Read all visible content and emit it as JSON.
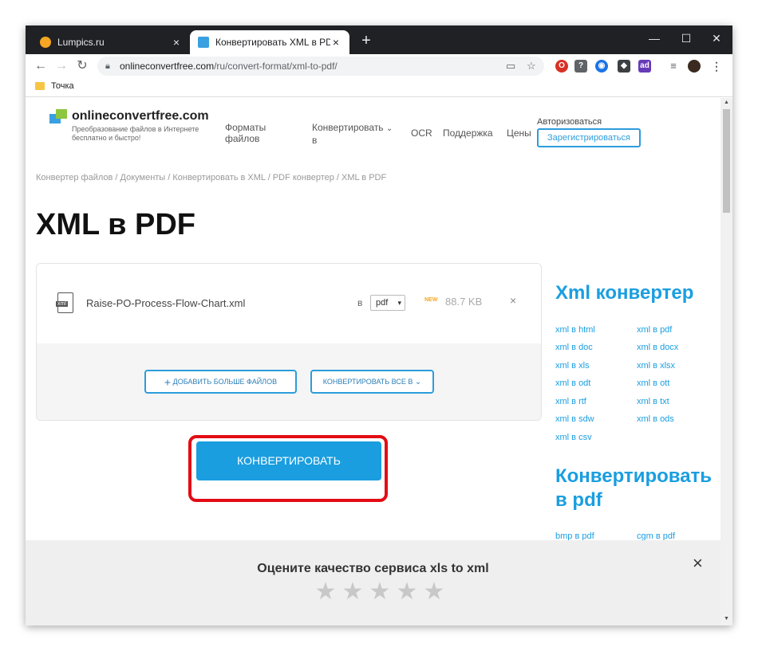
{
  "browser": {
    "tabs": [
      {
        "label": "Lumpics.ru",
        "favicon_color": "#f5a623"
      },
      {
        "label": "Конвертировать XML в PDF онлайн",
        "favicon_color": "#3aa0e0"
      }
    ],
    "url_domain": "onlineconvertfree.com",
    "url_path": "/ru/convert-format/xml-to-pdf/",
    "bookmarks": [
      {
        "label": "Точка"
      }
    ]
  },
  "site": {
    "logo_name": "onlineconvertfree.com",
    "logo_tagline": "Преобразование файлов в Интернете бесплатно и быстро!",
    "nav": {
      "formats_line1": "Форматы",
      "formats_line2": "файлов",
      "convert_line1": "Конвертировать",
      "convert_line2": "в",
      "ocr": "OCR",
      "support": "Поддержка",
      "prices": "Цены"
    },
    "login": "Авторизоваться",
    "register": "Зарегистрироваться"
  },
  "breadcrumbs": "Конвертер файлов / Документы / Конвертировать в XML / PDF конвертер / XML в PDF",
  "page_title": "XML в PDF",
  "converter": {
    "file": {
      "name": "Raise-PO-Process-Flow-Chart.xml",
      "icon_text": "xml",
      "to_label": "в",
      "format": "pdf",
      "new_badge": "NEW",
      "size": "88.7 KB",
      "remove": "×"
    },
    "add_more": "Добавить больше файлов",
    "convert_all": "Конвертировать все в",
    "convert_button": "Конвертировать"
  },
  "sidebar": {
    "xml_title": "Xml конвертер",
    "xml_links": [
      "xml в html",
      "xml в pdf",
      "xml в doc",
      "xml в docx",
      "xml в xls",
      "xml в xlsx",
      "xml в odt",
      "xml в ott",
      "xml в rtf",
      "xml в txt",
      "xml в sdw",
      "xml в ods",
      "xml в csv"
    ],
    "pdf_title_line1": "Конвертировать",
    "pdf_title_line2": "в pdf",
    "pdf_links": [
      "bmp в pdf",
      "cgm в pdf"
    ]
  },
  "rating": {
    "title": "Оцените качество сервиса xls to xml",
    "stars": 5,
    "close": "×"
  },
  "colors": {
    "accent": "#1a9ee0",
    "highlight": "#e30c14",
    "titlebar": "#202124"
  }
}
